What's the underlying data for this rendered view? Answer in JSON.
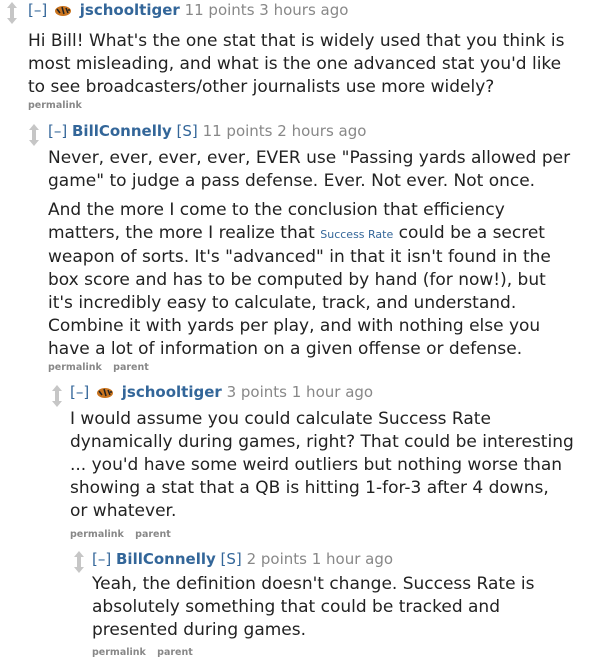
{
  "comments": [
    {
      "toggle": "[–]",
      "author": "jschooltiger",
      "flair": "",
      "points": "11 points",
      "time": "3 hours ago",
      "lines": [
        "Hi Bill! What's the one stat that is widely used that you think is",
        "most misleading, and what is the one advanced stat you'd like",
        "to see broadcasters/other journalists use more widely?"
      ],
      "buttons": [
        "permalink"
      ]
    },
    {
      "toggle": "[–]",
      "author": "BillConnelly",
      "flair": "[S]",
      "points": "11 points",
      "time": "2 hours ago",
      "p1": [
        "Never, ever, ever, ever, EVER use \"Passing yards allowed per",
        "game\" to judge a pass defense. Ever. Not ever. Not once."
      ],
      "p2_line1": "And the more I come to the conclusion that efficiency",
      "p2_line2": "matters, the more I realize that",
      "p2_inline": "Success Rate",
      "p2_line2_end": "could be a secret",
      "p2_rest": [
        "weapon of sorts. It's \"advanced\" in that it isn't found in the",
        "box score and has to be computed by hand (for now!), but",
        "it's incredibly easy to calculate, track, and understand.",
        "Combine it with yards per play, and with nothing else you",
        "have a lot of information on a given offense or defense."
      ],
      "buttons": [
        "permalink",
        "parent"
      ]
    },
    {
      "toggle": "[–]",
      "author": "jschooltiger",
      "flair": "",
      "points": "3 points",
      "time": "1 hour ago",
      "lines": [
        "I would assume you could calculate Success Rate",
        "dynamically during games, right? That could be interesting",
        "... you'd have some weird outliers but nothing worse than",
        "showing a stat that a QB is hitting 1-for-3 after 4 downs,",
        "or whatever."
      ],
      "buttons": [
        "permalink",
        "parent"
      ]
    },
    {
      "toggle": "[–]",
      "author": "BillConnelly",
      "flair": "[S]",
      "points": "2 points",
      "time": "1 hour ago",
      "lines": [
        "Yeah, the definition doesn't change. Success Rate is",
        "absolutely something that could be tracked and",
        "presented during games."
      ],
      "buttons": [
        "permalink",
        "parent"
      ]
    }
  ],
  "icons": {
    "vote": "updown-arrows-icon",
    "user": "tiger-icon"
  },
  "colors": {
    "author": "#336699",
    "meta": "#888888",
    "text": "#222222"
  }
}
